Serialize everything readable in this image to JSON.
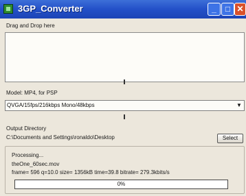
{
  "window": {
    "title": "3GP_Converter"
  },
  "drop": {
    "label": "Drag and Drop here"
  },
  "model": {
    "label": "Model: MP4, for PSP",
    "selected": "QVGA/15fps/216kbps Mono/48kbps"
  },
  "output": {
    "label": "Output Directory",
    "path": "C:\\Documents and Settings\\ronaldo\\Desktop",
    "select_label": "Select"
  },
  "processing": {
    "heading": "Processing...",
    "file": "theOne_60sec.mov",
    "stats": "frame= 596 q=10.0 size= 1356kB time=39.8 bitrate= 279.3kbits/s",
    "progress_text": "0%",
    "progress_value": 0
  },
  "colors": {
    "titlebar": "#2350c8",
    "close": "#d9512b",
    "progress_fill": "#3a6ee6"
  }
}
